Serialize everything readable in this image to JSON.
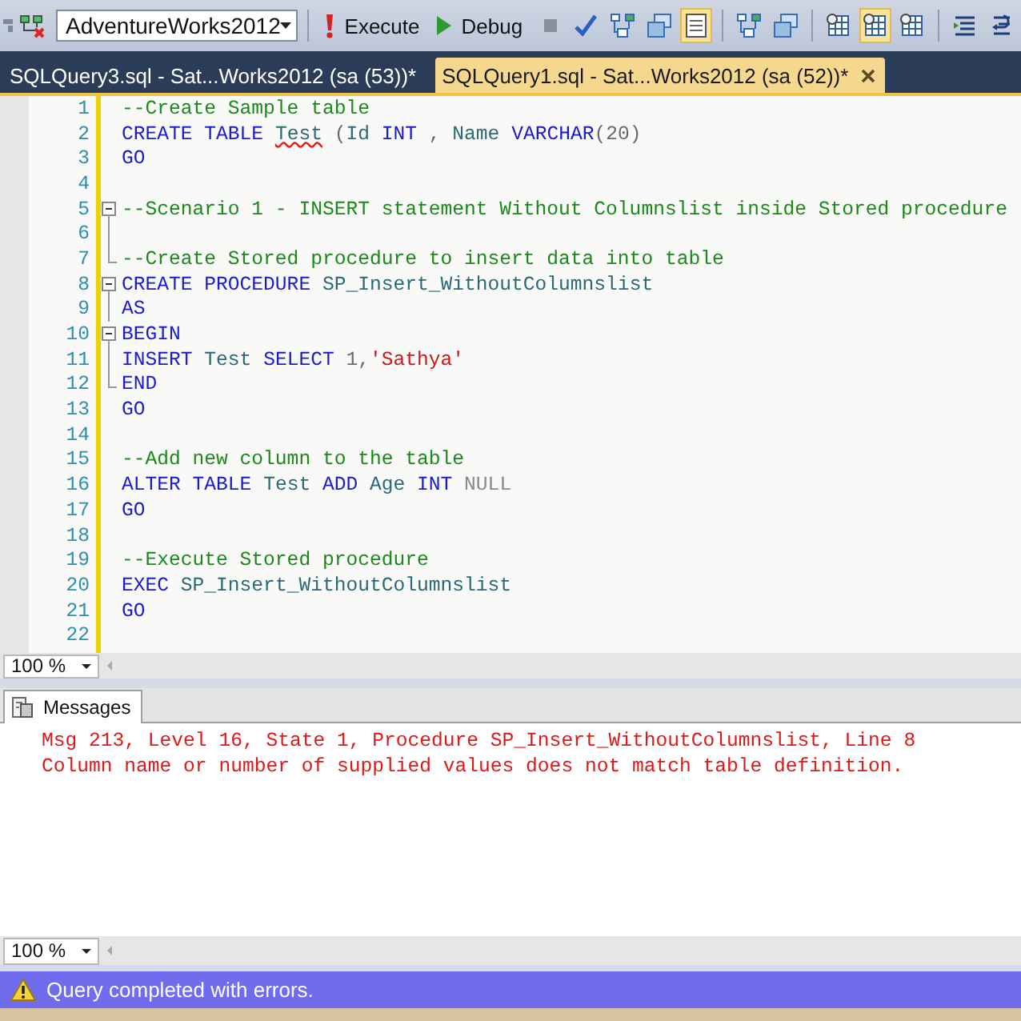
{
  "toolbar": {
    "leading_icons": [
      {
        "kind": "partial"
      },
      {
        "kind": "connect"
      }
    ],
    "database": "AdventureWorks2012",
    "buttons": [
      {
        "kind": "execute",
        "label": "Execute"
      },
      {
        "kind": "debug",
        "label": "Debug"
      }
    ],
    "icon_groups": [
      [
        {
          "kind": "stop",
          "selected": false
        },
        {
          "kind": "check",
          "selected": false
        },
        {
          "kind": "tree",
          "selected": false
        },
        {
          "kind": "windows",
          "selected": false
        },
        {
          "kind": "results",
          "selected": true
        }
      ],
      [
        {
          "kind": "tree",
          "selected": false
        },
        {
          "kind": "windows",
          "selected": false
        }
      ],
      [
        {
          "kind": "grid",
          "selected": false
        },
        {
          "kind": "grid",
          "selected": true
        },
        {
          "kind": "grid",
          "selected": false
        }
      ],
      [
        {
          "kind": "lines",
          "selected": false
        },
        {
          "kind": "uncomment",
          "selected": false
        }
      ]
    ]
  },
  "tabs": [
    {
      "label": "SQLQuery3.sql - Sat...Works2012 (sa (53))*",
      "selected": false
    },
    {
      "label": "SQLQuery1.sql - Sat...Works2012 (sa (52))*",
      "selected": true
    }
  ],
  "editor": {
    "lines": [
      {
        "number": "1",
        "kind": "plain",
        "tokens": [
          {
            "kind": "comment",
            "text": "--Create Sample table"
          }
        ]
      },
      {
        "number": "2",
        "kind": "plain",
        "tokens": [
          {
            "kind": "keyword",
            "text": "CREATE TABLE "
          },
          {
            "kind": "ident",
            "text": "Test",
            "squiggle": true
          },
          {
            "kind": "plain",
            "text": " ("
          },
          {
            "kind": "ident",
            "text": "Id"
          },
          {
            "kind": "keyword",
            "text": " INT"
          },
          {
            "kind": "plain",
            "text": " , "
          },
          {
            "kind": "ident",
            "text": "Name"
          },
          {
            "kind": "keyword",
            "text": " VARCHAR"
          },
          {
            "kind": "plain",
            "text": "(20)"
          }
        ]
      },
      {
        "number": "3",
        "kind": "plain",
        "tokens": [
          {
            "kind": "keyword",
            "text": "GO"
          }
        ]
      },
      {
        "number": "4",
        "kind": "plain"
      },
      {
        "number": "5",
        "kind": "fold-start",
        "tokens": [
          {
            "kind": "comment",
            "text": "--Scenario 1 - INSERT statement Without Columnslist inside Stored procedure"
          }
        ]
      },
      {
        "number": "6",
        "kind": "fold-line"
      },
      {
        "number": "7",
        "kind": "fold-end",
        "tokens": [
          {
            "kind": "comment",
            "text": "--Create Stored procedure to insert data into table"
          }
        ]
      },
      {
        "number": "8",
        "kind": "fold-start",
        "tokens": [
          {
            "kind": "keyword",
            "text": "CREATE PROCEDURE "
          },
          {
            "kind": "ident",
            "text": "SP_Insert_WithoutColumnslist"
          }
        ]
      },
      {
        "number": "9",
        "kind": "fold-line",
        "tokens": [
          {
            "kind": "keyword",
            "text": "AS"
          }
        ]
      },
      {
        "number": "10",
        "kind": "fold-start",
        "tokens": [
          {
            "kind": "keyword",
            "text": "BEGIN"
          }
        ]
      },
      {
        "number": "11",
        "kind": "fold-line",
        "tokens": [
          {
            "kind": "keyword",
            "text": "INSERT "
          },
          {
            "kind": "ident",
            "text": "Test"
          },
          {
            "kind": "keyword",
            "text": " SELECT"
          },
          {
            "kind": "plain",
            "text": " 1,"
          },
          {
            "kind": "string",
            "text": "'Sathya'"
          }
        ]
      },
      {
        "number": "12",
        "kind": "fold-end",
        "tokens": [
          {
            "kind": "keyword",
            "text": "END"
          }
        ]
      },
      {
        "number": "13",
        "kind": "plain",
        "tokens": [
          {
            "kind": "keyword",
            "text": "GO"
          }
        ]
      },
      {
        "number": "14",
        "kind": "plain"
      },
      {
        "number": "15",
        "kind": "plain",
        "tokens": [
          {
            "kind": "comment",
            "text": "--Add new column to the table"
          }
        ]
      },
      {
        "number": "16",
        "kind": "plain",
        "tokens": [
          {
            "kind": "keyword",
            "text": "ALTER TABLE "
          },
          {
            "kind": "ident",
            "text": "Test"
          },
          {
            "kind": "keyword",
            "text": " ADD "
          },
          {
            "kind": "ident",
            "text": "Age"
          },
          {
            "kind": "keyword",
            "text": " INT"
          },
          {
            "kind": "operator",
            "text": " NULL"
          }
        ]
      },
      {
        "number": "17",
        "kind": "plain",
        "tokens": [
          {
            "kind": "keyword",
            "text": "GO"
          }
        ]
      },
      {
        "number": "18",
        "kind": "plain"
      },
      {
        "number": "19",
        "kind": "plain",
        "tokens": [
          {
            "kind": "comment",
            "text": "--Execute Stored procedure"
          }
        ]
      },
      {
        "number": "20",
        "kind": "plain",
        "tokens": [
          {
            "kind": "keyword",
            "text": "EXEC "
          },
          {
            "kind": "ident",
            "text": "SP_Insert_WithoutColumnslist"
          }
        ]
      },
      {
        "number": "21",
        "kind": "plain",
        "tokens": [
          {
            "kind": "keyword",
            "text": "GO"
          }
        ]
      },
      {
        "number": "22",
        "kind": "plain"
      }
    ],
    "zoom": "100 %"
  },
  "results": {
    "tab": "Messages",
    "messages": [
      "Msg 213, Level 16, State 1, Procedure SP_Insert_WithoutColumnslist, Line 8",
      "Column name or number of supplied values does not match table definition."
    ],
    "zoom": "100 %"
  },
  "status_bar": {
    "kind": "error",
    "text": "Query completed with errors."
  }
}
